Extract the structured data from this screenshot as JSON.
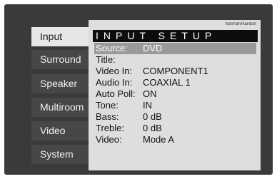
{
  "menu": {
    "tabs": [
      {
        "label": "Input"
      },
      {
        "label": "Surround"
      },
      {
        "label": "Speaker"
      },
      {
        "label": "Multiroom"
      },
      {
        "label": "Video"
      },
      {
        "label": "System"
      }
    ]
  },
  "panel": {
    "brand": "harman/kardon",
    "title": "INPUT SETUP",
    "rows": [
      {
        "label": "Source:",
        "value": "DVD"
      },
      {
        "label": "Title:",
        "value": ""
      },
      {
        "label": "Video In:",
        "value": "COMPONENT1"
      },
      {
        "label": "Audio In:",
        "value": "COAXIAL 1"
      },
      {
        "label": "Auto Poll:",
        "value": "ON"
      },
      {
        "label": "Tone:",
        "value": "IN"
      },
      {
        "label": "Bass:",
        "value": "0 dB"
      },
      {
        "label": "Treble:",
        "value": "0 dB"
      },
      {
        "label": "Video:",
        "value": "Mode A"
      }
    ]
  },
  "colors": {
    "background": "#3a3a3a",
    "panel": "#dedede",
    "highlight": "#9a9a9a",
    "title_bar": "#0d0d0d"
  }
}
